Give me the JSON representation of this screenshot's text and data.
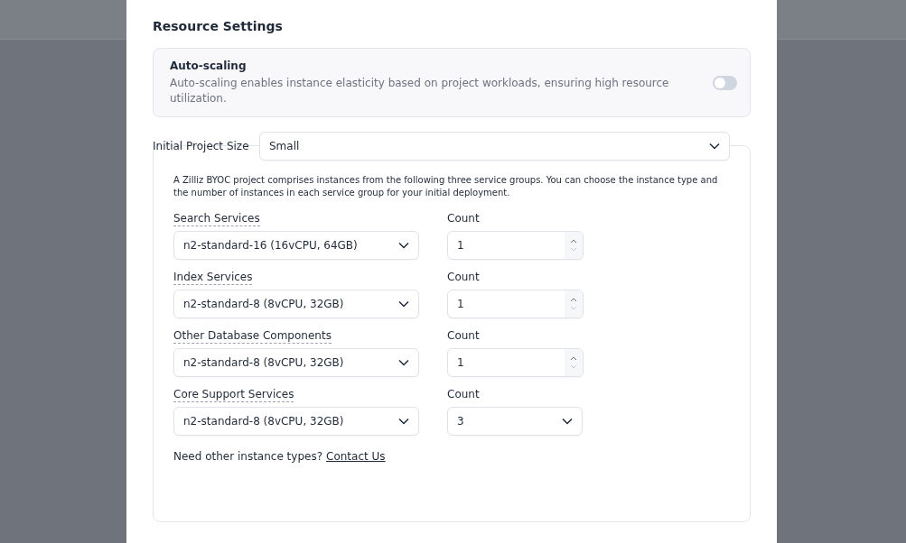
{
  "section_title": "Resource Settings",
  "auto_scaling": {
    "title": "Auto-scaling",
    "description": "Auto-scaling enables instance elasticity based on project workloads, ensuring high resource utilization.",
    "on": false
  },
  "project_size": {
    "label": "Initial Project Size",
    "value": "Small"
  },
  "intro": "A Zilliz BYOC project comprises instances from the following three service groups. You can choose the instance type and the number of instances in each service group for your initial deployment.",
  "services": [
    {
      "label": "Search Services",
      "instance": "n2-standard-16 (16vCPU, 64GB)",
      "count_label": "Count",
      "count": "1",
      "kind": "number"
    },
    {
      "label": "Index Services",
      "instance": "n2-standard-8 (8vCPU, 32GB)",
      "count_label": "Count",
      "count": "1",
      "kind": "number"
    },
    {
      "label": "Other Database Components",
      "instance": "n2-standard-8 (8vCPU, 32GB)",
      "count_label": "Count",
      "count": "1",
      "kind": "number"
    },
    {
      "label": "Core Support Services",
      "instance": "n2-standard-8 (8vCPU, 32GB)",
      "count_label": "Count",
      "count": "3",
      "kind": "select"
    }
  ],
  "footer": {
    "text": "Need other instance types?",
    "link": "Contact Us"
  }
}
